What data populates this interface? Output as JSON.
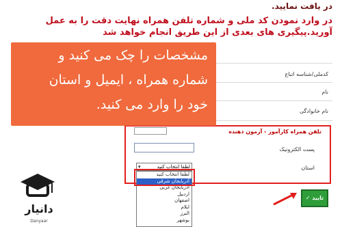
{
  "notice": {
    "line0": "در یافت نمایید.",
    "line1": "در وارد نمودن کد ملی و شماره تلفن همراه نهایت دقت را به عمل",
    "line2": "آورید.پیگیری های بعدی از این طریق انجام خواهد شد"
  },
  "form": {
    "national_code_label": "کدملی/شناسه اتباع",
    "first_name_label": "نام",
    "last_name_label": "نام خانوادگی",
    "mobile_label": "تلفن همراه کارآموز - آزمون دهنده",
    "email_label": "پست الکترونیک",
    "province_label": "استان",
    "province_selected": "لطفا انتخاب کنید",
    "province_options": [
      "لطفا انتخاب کنید",
      "آذربایجان شرقی",
      "آذربایجان غربی",
      "اردبیل",
      "اصفهان",
      "ایلام",
      "البرز",
      "بوشهر"
    ]
  },
  "overlay": {
    "line1": "مشخصات را چک می کنید و",
    "line2": "شماره همراه ، ایمیل و استان",
    "line3": "خود را وارد می کنید."
  },
  "confirm_button": {
    "label": "تایید ✓"
  },
  "logo": {
    "name": "دانیار",
    "latin": "Danyaar"
  },
  "colors": {
    "highlight": "#e21d1d",
    "overlay": "#f06a3d",
    "confirm": "#2e9e3a",
    "notice": "#c0101e"
  }
}
